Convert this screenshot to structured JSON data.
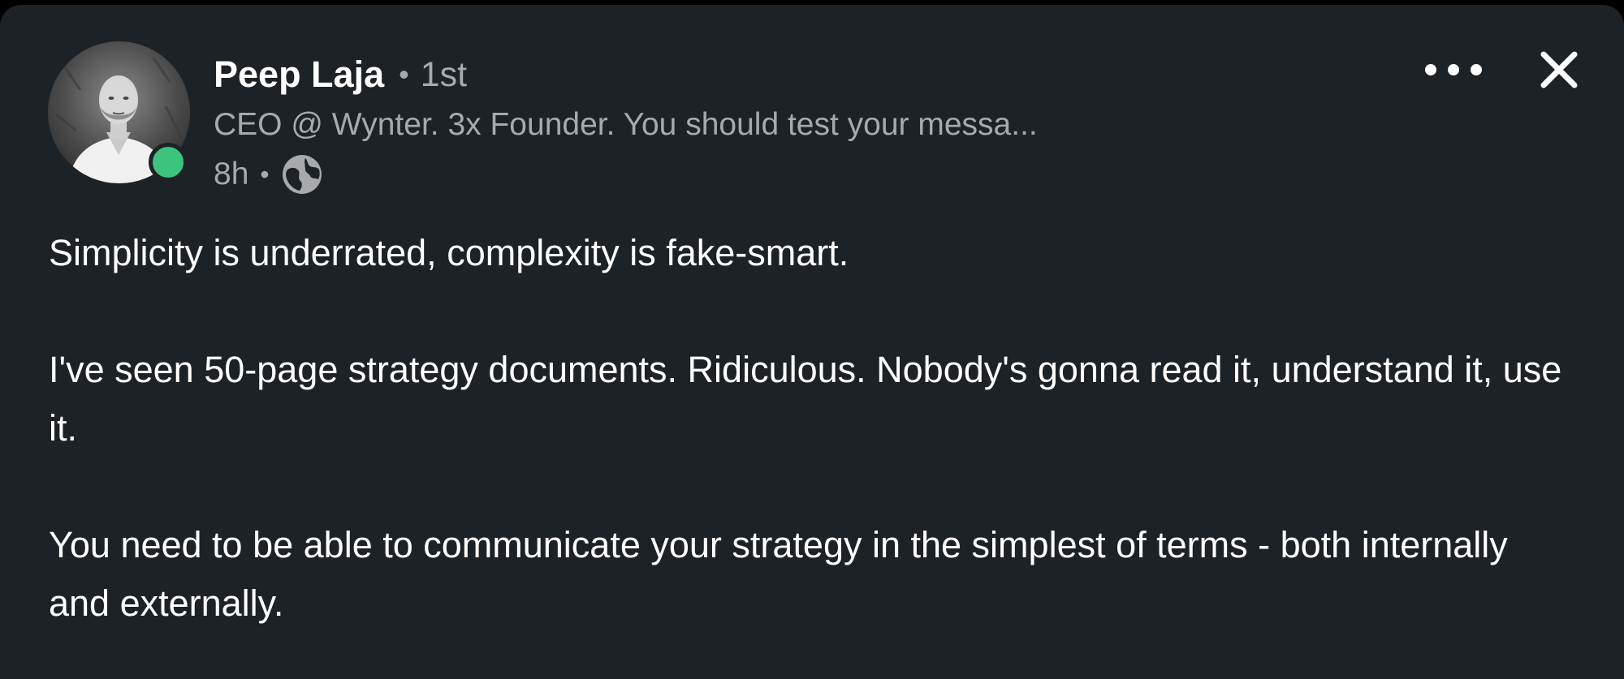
{
  "author": {
    "name": "Peep Laja",
    "separator": "•",
    "connection_degree": "1st",
    "headline": "CEO @ Wynter. 3x Founder. You should test your messa...",
    "post_time": "8h",
    "meta_separator": "•",
    "visibility_icon": "globe-icon",
    "avatar_icon": "profile-photo",
    "online_status": "online",
    "status_color": "#3cc47c"
  },
  "actions": {
    "more_icon": "ellipsis-icon",
    "close_icon": "close-icon"
  },
  "post": {
    "paragraphs": [
      "Simplicity is underrated, complexity is fake-smart.",
      "I've seen 50-page strategy documents. Ridiculous. Nobody's gonna read it, understand it, use it.",
      "You need to be able to communicate your strategy in the simplest of terms - both internally and externally."
    ]
  },
  "colors": {
    "background": "#1d2226",
    "primary_text": "#ffffff",
    "secondary_text": "#a7a9ab"
  }
}
